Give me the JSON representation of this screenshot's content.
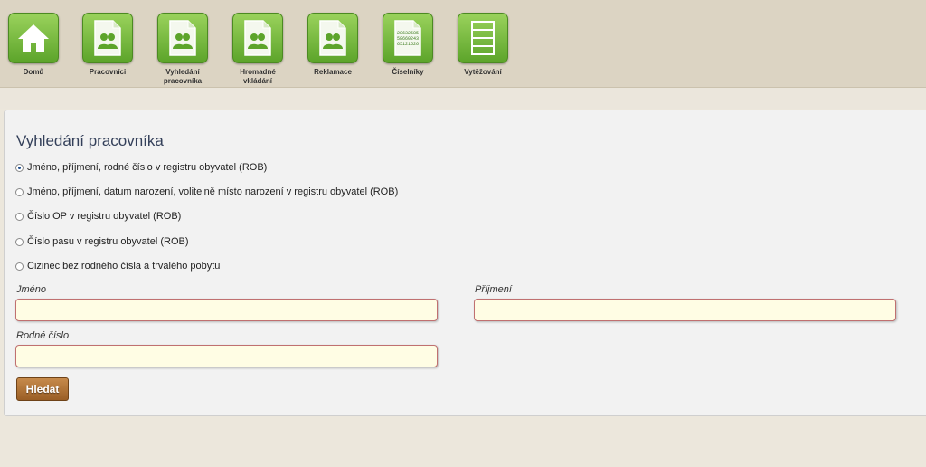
{
  "nav": {
    "items": [
      {
        "label": "Domů",
        "icon": "home-icon"
      },
      {
        "label": "Pracovníci",
        "icon": "people-document-icon"
      },
      {
        "label": "Vyhledání pracovníka",
        "icon": "people-document-icon"
      },
      {
        "label": "Hromadné vkládání",
        "icon": "people-document-icon"
      },
      {
        "label": "Reklamace",
        "icon": "people-document-icon"
      },
      {
        "label": "Číselníky",
        "icon": "codebook-document-icon",
        "icon_text": [
          "28632585",
          "58660243",
          "65121526"
        ]
      },
      {
        "label": "Vytěžování",
        "icon": "list-icon"
      }
    ]
  },
  "form": {
    "title": "Vyhledání pracovníka",
    "options": [
      {
        "label": "Jméno, příjmení, rodné číslo v registru obyvatel (ROB)",
        "checked": true
      },
      {
        "label": "Jméno, příjmení, datum narození, volitelně místo narození v registru obyvatel (ROB)",
        "checked": false
      },
      {
        "label": "Číslo OP v registru obyvatel (ROB)",
        "checked": false
      },
      {
        "label": "Číslo pasu v registru obyvatel (ROB)",
        "checked": false
      },
      {
        "label": "Cizinec bez rodného čísla a trvalého pobytu",
        "checked": false
      }
    ],
    "fields": {
      "first_name_label": "Jméno",
      "first_name_value": "",
      "last_name_label": "Příjmení",
      "last_name_value": "",
      "birth_number_label": "Rodné číslo",
      "birth_number_value": ""
    },
    "search_label": "Hledat"
  },
  "colors": {
    "tile_green": "#6cb33a",
    "input_bg": "#fffde4",
    "button_brown": "#b07535",
    "title_color": "#34405a"
  }
}
